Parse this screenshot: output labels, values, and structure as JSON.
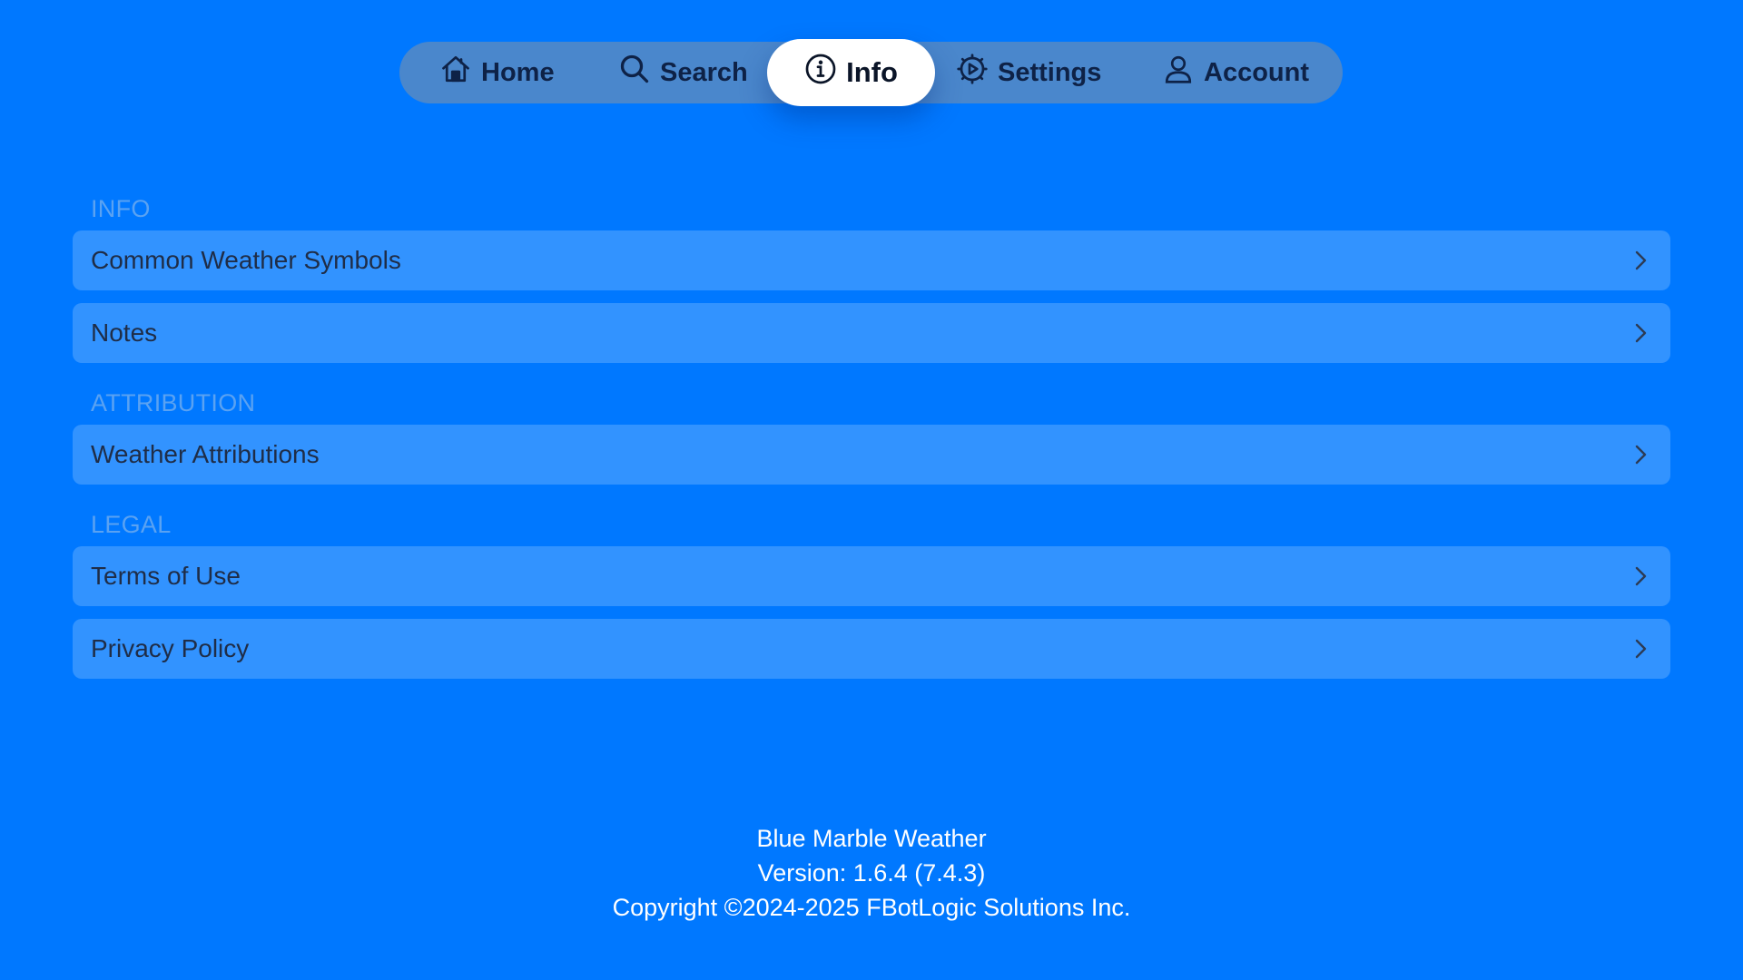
{
  "colors": {
    "background": "#0078FF",
    "tabbar": "#4A87CC",
    "row": "#3293FF",
    "section_header": "#5AA2F2",
    "active_tab": "#FFFFFF"
  },
  "tabs": {
    "home": {
      "label": "Home",
      "icon": "house-icon"
    },
    "search": {
      "label": "Search",
      "icon": "magnifier-icon"
    },
    "info": {
      "label": "Info",
      "icon": "info-circle-icon",
      "active": true
    },
    "settings": {
      "label": "Settings",
      "icon": "gear-icon"
    },
    "account": {
      "label": "Account",
      "icon": "person-icon"
    }
  },
  "sections": {
    "info": {
      "header": "INFO",
      "items": [
        "Common Weather Symbols",
        "Notes"
      ]
    },
    "attribution": {
      "header": "ATTRIBUTION",
      "items": [
        "Weather Attributions"
      ]
    },
    "legal": {
      "header": "LEGAL",
      "items": [
        "Terms of Use",
        "Privacy Policy"
      ]
    }
  },
  "footer": {
    "app_name": "Blue Marble Weather",
    "version": "Version: 1.6.4 (7.4.3)",
    "copyright": "Copyright ©2024-2025 FBotLogic Solutions Inc."
  }
}
